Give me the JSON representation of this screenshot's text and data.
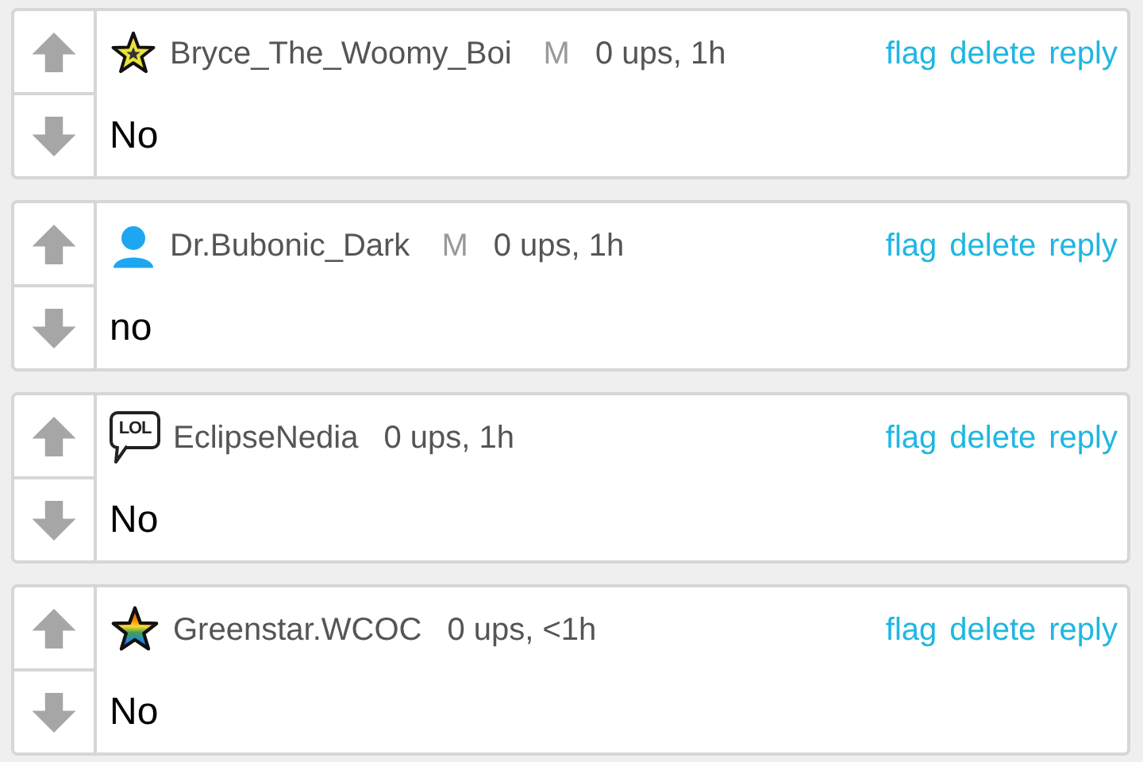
{
  "comments": [
    {
      "badge": {
        "kind": "star"
      },
      "username": "Bryce_The_Woomy_Boi",
      "mod_mark": "M",
      "meta": "0 ups, 1h",
      "actions": [
        "flag",
        "delete",
        "reply"
      ],
      "text": "No"
    },
    {
      "badge": {
        "kind": "user"
      },
      "username": "Dr.Bubonic_Dark",
      "mod_mark": "M",
      "meta": "0 ups, 1h",
      "actions": [
        "flag",
        "delete",
        "reply"
      ],
      "text": "no"
    },
    {
      "badge": {
        "kind": "lol",
        "label": "LOL"
      },
      "username": "EclipseNedia",
      "meta": "0 ups, 1h",
      "actions": [
        "flag",
        "delete",
        "reply"
      ],
      "text": "No"
    },
    {
      "badge": {
        "kind": "rainbow-star"
      },
      "username": "Greenstar.WCOC",
      "meta": "0 ups, <1h",
      "actions": [
        "flag",
        "delete",
        "reply"
      ],
      "text": "No"
    }
  ]
}
